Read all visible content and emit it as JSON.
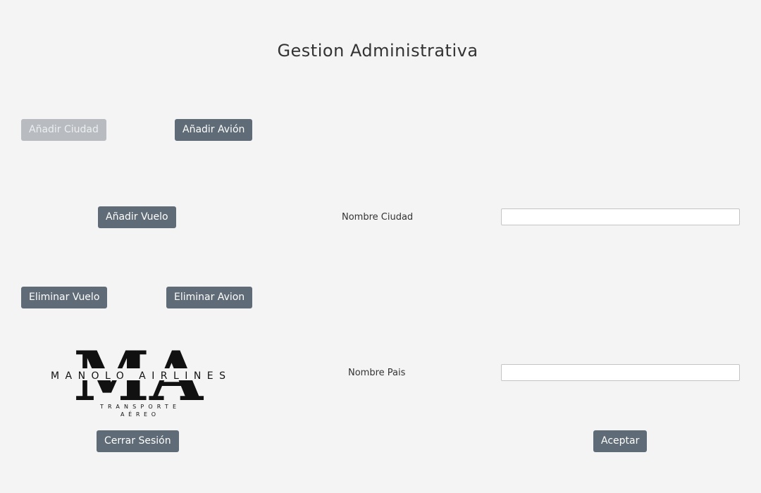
{
  "header": {
    "title": "Gestion Administrativa"
  },
  "buttons": {
    "add_city": "Añadir Ciudad",
    "add_plane": "Añadir Avión",
    "add_flight": "Añadir Vuelo",
    "delete_flight": "Eliminar Vuelo",
    "delete_plane": "Eliminar Avion",
    "logout": "Cerrar Sesión",
    "accept": "Aceptar"
  },
  "button_states": {
    "add_city_enabled": false
  },
  "form": {
    "city_name_label": "Nombre Ciudad",
    "city_name_value": "",
    "country_name_label": "Nombre Pais",
    "country_name_value": ""
  },
  "logo": {
    "monogram": "MA",
    "brand": "MANOLO AIRLINES",
    "tagline_line1": "TRANSPORTE",
    "tagline_line2": "AÉREO"
  },
  "colors": {
    "button_bg": "#5f6b77",
    "button_disabled_bg": "#b8bcc0",
    "background": "#f4f4f4"
  }
}
